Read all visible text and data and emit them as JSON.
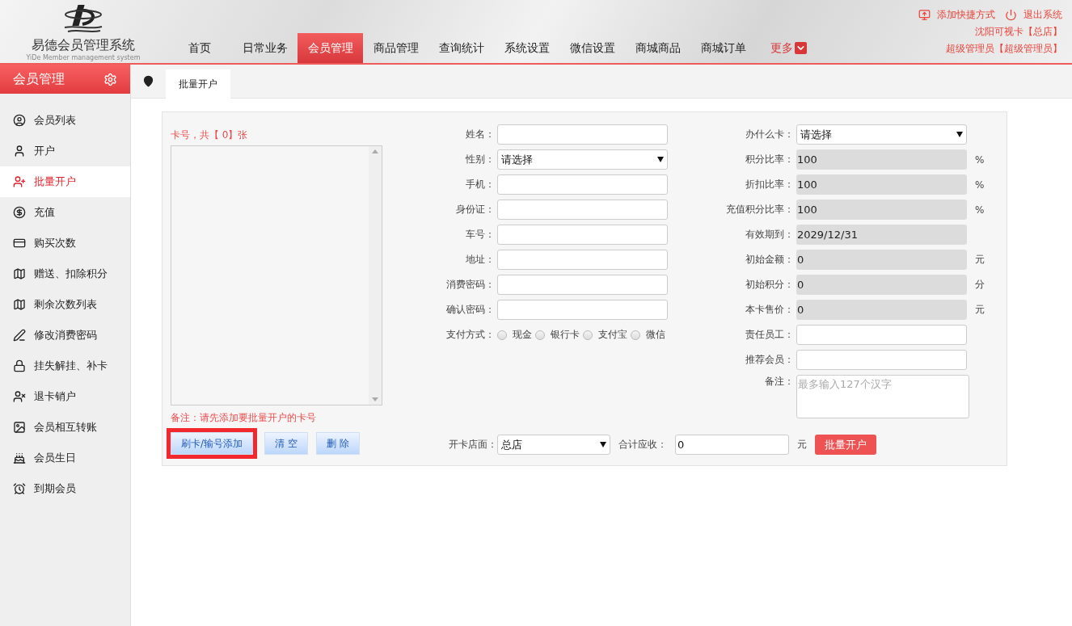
{
  "header": {
    "logo_title": "易德会员管理系统",
    "logo_subtitle": "YiDe Member management system",
    "nav": [
      {
        "label": "首页",
        "selected": false
      },
      {
        "label": "日常业务",
        "selected": false
      },
      {
        "label": "会员管理",
        "selected": true
      },
      {
        "label": "商品管理",
        "selected": false
      },
      {
        "label": "查询统计",
        "selected": false
      },
      {
        "label": "系统设置",
        "selected": false
      },
      {
        "label": "微信设置",
        "selected": false
      },
      {
        "label": "商城商品",
        "selected": false
      },
      {
        "label": "商城订单",
        "selected": false
      }
    ],
    "more": "更多",
    "links": [
      {
        "kind": "shortcut",
        "label": "添加快捷方式"
      },
      {
        "kind": "logout",
        "label": "退出系统"
      }
    ],
    "store": "沈阳可视卡【总店】",
    "user": "超级管理员【超级管理员】"
  },
  "sidebar": {
    "title": "会员管理",
    "items": [
      {
        "label": "会员列表",
        "selected": false
      },
      {
        "label": "开户",
        "selected": false
      },
      {
        "label": "批量开户",
        "selected": true
      },
      {
        "label": "充值",
        "selected": false
      },
      {
        "label": "购买次数",
        "selected": false
      },
      {
        "label": "赠送、扣除积分",
        "selected": false
      },
      {
        "label": "剩余次数列表",
        "selected": false
      },
      {
        "label": "修改消费密码",
        "selected": false
      },
      {
        "label": "挂失解挂、补卡",
        "selected": false
      },
      {
        "label": "退卡销户",
        "selected": false
      },
      {
        "label": "会员相互转账",
        "selected": false
      },
      {
        "label": "会员生日",
        "selected": false
      },
      {
        "label": "到期会员",
        "selected": false
      }
    ]
  },
  "tabs": [
    {
      "label": "批量开户",
      "selected": true
    }
  ],
  "form": {
    "card_count": "卡号，共【 0】张",
    "note": "备注：请先添加要批量开户的卡号",
    "buttons": [
      {
        "label": "刷卡/输号添加",
        "highlighted": true
      },
      {
        "label": "清 空",
        "highlighted": false
      },
      {
        "label": "删 除",
        "highlighted": false
      }
    ],
    "middle_fields": [
      {
        "kind": "input",
        "label": "姓名："
      },
      {
        "kind": "select",
        "label": "性别：",
        "value": "请选择"
      },
      {
        "kind": "input",
        "label": "手机："
      },
      {
        "kind": "input",
        "label": "身份证："
      },
      {
        "kind": "input",
        "label": "车号："
      },
      {
        "kind": "input",
        "label": "地址："
      },
      {
        "kind": "input",
        "label": "消费密码："
      },
      {
        "kind": "input",
        "label": "确认密码："
      },
      {
        "kind": "radio",
        "label": "支付方式：",
        "options": [
          {
            "label": "现金",
            "selected": false
          },
          {
            "label": "银行卡",
            "selected": false
          },
          {
            "label": "支付宝",
            "selected": false
          },
          {
            "label": "微信",
            "selected": false
          }
        ]
      }
    ],
    "right_fields": [
      {
        "kind": "select",
        "label": "办什么卡：",
        "value": "请选择"
      },
      {
        "kind": "readonly",
        "label": "积分比率：",
        "value": "100",
        "unit": "%"
      },
      {
        "kind": "readonly",
        "label": "折扣比率：",
        "value": "100",
        "unit": "%"
      },
      {
        "kind": "readonly",
        "label": "充值积分比率：",
        "value": "100",
        "unit": "%"
      },
      {
        "kind": "readonly",
        "label": "有效期到：",
        "value": "2029/12/31"
      },
      {
        "kind": "readonly",
        "label": "初始金额：",
        "value": "0",
        "unit": "元"
      },
      {
        "kind": "readonly",
        "label": "初始积分：",
        "value": "0",
        "unit": "分"
      },
      {
        "kind": "readonly",
        "label": "本卡售价：",
        "value": "0",
        "unit": "元"
      },
      {
        "kind": "input",
        "label": "责任员工："
      },
      {
        "kind": "input",
        "label": "推荐会员："
      },
      {
        "kind": "textarea",
        "label": "备注：",
        "placeholder": "最多输入127个汉字"
      }
    ],
    "footer": {
      "store_label": "开卡店面：",
      "store_value": "总店",
      "total_label": "合计应收：",
      "total_value": "0",
      "total_unit": "元",
      "submit": "批量开户"
    }
  }
}
